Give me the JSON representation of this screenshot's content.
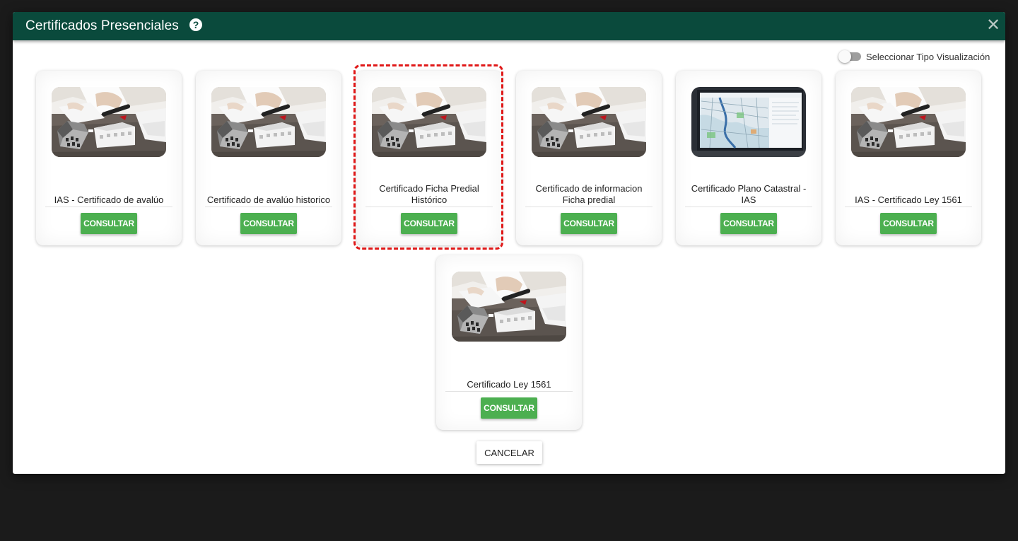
{
  "dialog": {
    "title": "Certificados Presenciales",
    "help_icon": "?",
    "close_icon": "✕"
  },
  "toggle": {
    "label": "Seleccionar Tipo Visualización",
    "checked": false
  },
  "cards": [
    {
      "title": "IAS - Certificado de avalúo",
      "button": "CONSULTAR",
      "image": "houses-documents-photo"
    },
    {
      "title": "Certificado de avalúo historico",
      "button": "CONSULTAR",
      "image": "houses-documents-photo"
    },
    {
      "title": "Certificado Ficha Predial Histórico",
      "button": "CONSULTAR",
      "image": "houses-documents-photo",
      "highlighted": true
    },
    {
      "title": "Certificado de informacion Ficha predial",
      "button": "CONSULTAR",
      "image": "houses-documents-photo"
    },
    {
      "title": "Certificado Plano Catastral - IAS",
      "button": "CONSULTAR",
      "image": "laptop-map-photo"
    },
    {
      "title": "IAS - Certificado Ley 1561",
      "button": "CONSULTAR",
      "image": "houses-documents-photo"
    },
    {
      "title": "Certificado Ley 1561",
      "button": "CONSULTAR",
      "image": "houses-documents-photo"
    }
  ],
  "actions": {
    "cancel": "CANCELAR"
  },
  "colors": {
    "header": "#0a4a3c",
    "button": "#4caf50",
    "highlight": "#e01818"
  }
}
